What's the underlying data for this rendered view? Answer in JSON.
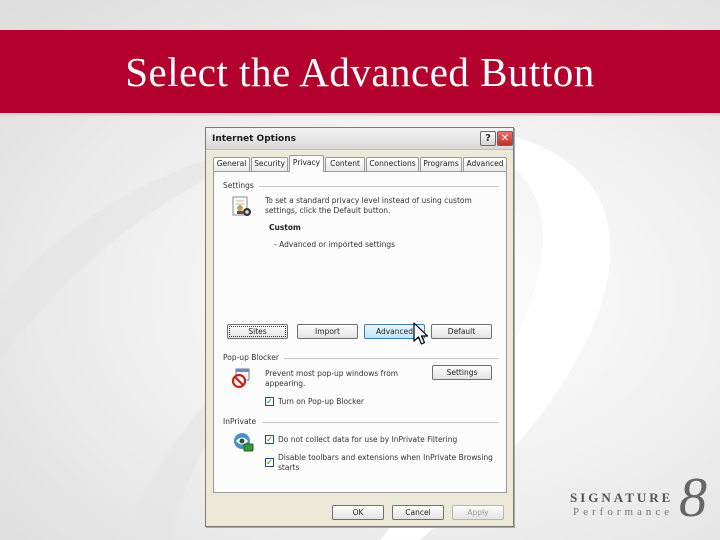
{
  "slide": {
    "title": "Select the Advanced Button",
    "accent_color": "#b3002d"
  },
  "dialog": {
    "title": "Internet Options",
    "help_glyph": "?",
    "close_glyph": "✕",
    "tabs": [
      {
        "label": "General"
      },
      {
        "label": "Security"
      },
      {
        "label": "Privacy"
      },
      {
        "label": "Content"
      },
      {
        "label": "Connections"
      },
      {
        "label": "Programs"
      },
      {
        "label": "Advanced"
      }
    ],
    "active_tab": "Privacy",
    "settings": {
      "group_label": "Settings",
      "description_line1": "To set a standard privacy level instead of using custom",
      "description_line2": "settings, click the Default button.",
      "level": "Custom",
      "level_detail": "- Advanced or imported settings",
      "buttons": {
        "sites": "Sites",
        "import": "Import",
        "advanced": "Advanced",
        "default": "Default"
      }
    },
    "popup": {
      "group_label": "Pop-up Blocker",
      "description_line1": "Prevent most pop-up windows from",
      "description_line2": "appearing.",
      "settings_button": "Settings",
      "checkbox_label": "Turn on Pop-up Blocker",
      "checked": true
    },
    "inprivate": {
      "group_label": "InPrivate",
      "checkbox1_label": "Do not collect data for use by InPrivate Filtering",
      "checkbox1_checked": true,
      "checkbox2_line1": "Disable toolbars and extensions when InPrivate Browsing",
      "checkbox2_line2": "starts",
      "checkbox2_checked": true
    },
    "footer": {
      "ok": "OK",
      "cancel": "Cancel",
      "apply": "Apply"
    },
    "check_glyph": "✓"
  },
  "logo": {
    "main": "SIGNATURE",
    "sub": "Performance",
    "mark": "8"
  },
  "icons": {
    "privacy": "privacy-settings-icon",
    "popup": "popup-blocker-icon",
    "inprivate": "inprivate-icon",
    "cursor": "mouse-pointer-icon"
  }
}
